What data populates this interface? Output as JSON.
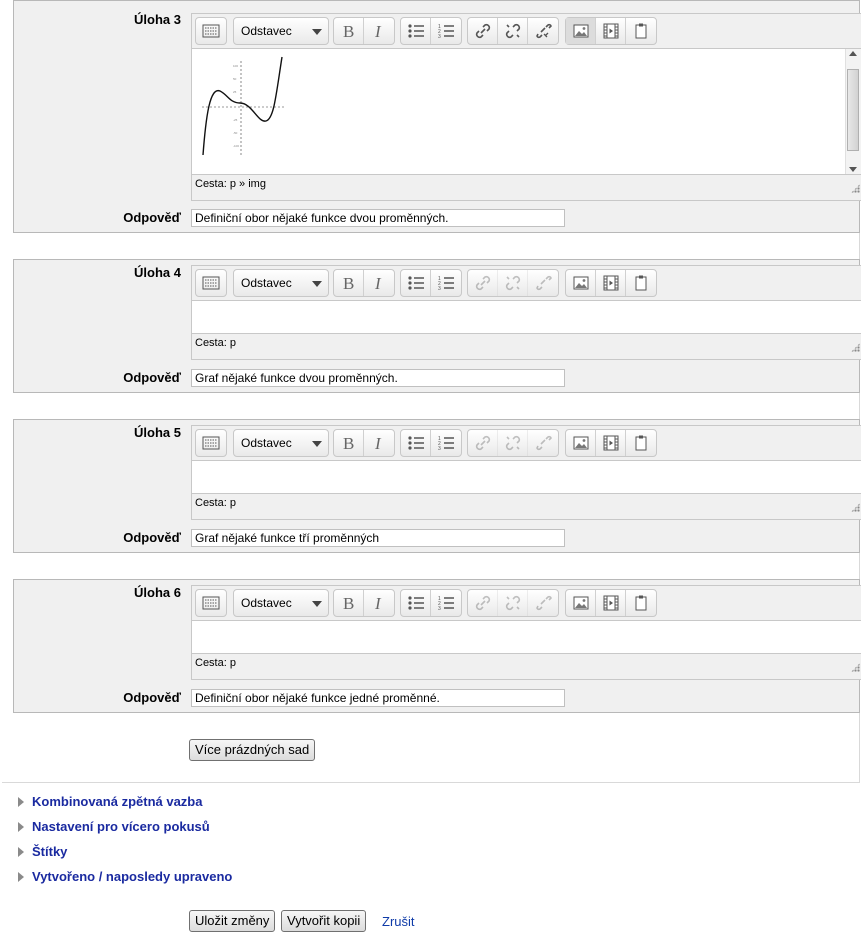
{
  "editor": {
    "format_label": "Odstavec",
    "path_prefix": "Cesta:",
    "path_img": "p » img",
    "path_p": "p"
  },
  "tasks": [
    {
      "label": "Úloha 3",
      "answer_label": "Odpověď",
      "answer": "Definiční obor nějaké funkce dvou proměnných."
    },
    {
      "label": "Úloha 4",
      "answer_label": "Odpověď",
      "answer": "Graf nějaké funkce dvou proměnných."
    },
    {
      "label": "Úloha 5",
      "answer_label": "Odpověď",
      "answer": "Graf nějaké funkce tří proměnných"
    },
    {
      "label": "Úloha 6",
      "answer_label": "Odpověď",
      "answer": "Definiční obor nějaké funkce jedné proměnné."
    }
  ],
  "more_button": "Více prázdných sad",
  "sections": [
    "Kombinovaná zpětná vazba",
    "Nastavení pro vícero pokusů",
    "Štítky",
    "Vytvořeno / naposledy upraveno"
  ],
  "actions": {
    "save": "Uložit změny",
    "copy": "Vytvořit kopii",
    "cancel": "Zrušit"
  },
  "icons": [
    "toolbar-toggle-icon",
    "bold-icon",
    "italic-icon",
    "bullet-list-icon",
    "numbered-list-icon",
    "link-icon",
    "unlink-icon",
    "anchor-icon",
    "image-icon",
    "media-icon",
    "paste-icon"
  ]
}
